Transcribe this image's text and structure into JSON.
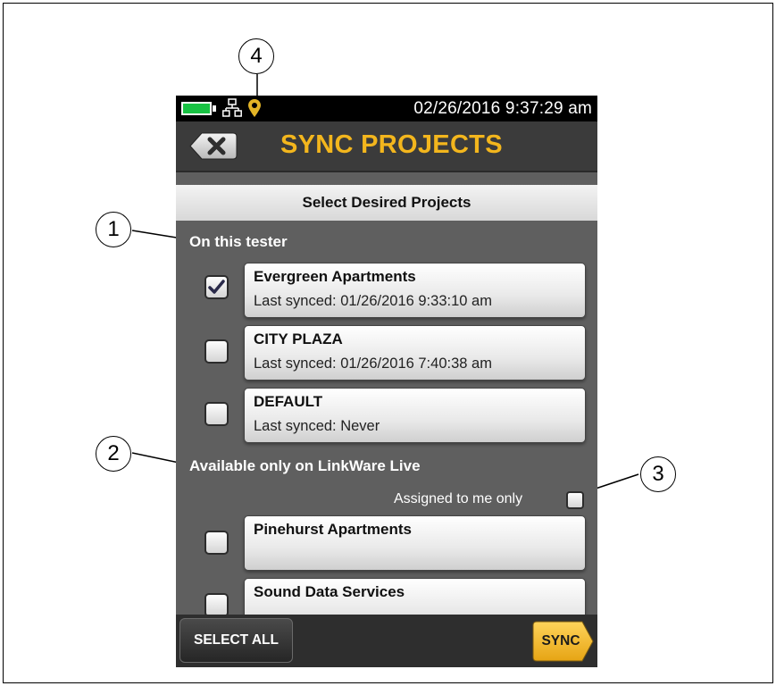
{
  "status": {
    "datetime": "02/26/2016 9:37:29 am",
    "battery_color": "#18c243"
  },
  "header": {
    "title": "SYNC PROJECTS",
    "title_color": "#f3b61d",
    "back_icon": "close-x-icon"
  },
  "subheader": "Select Desired Projects",
  "sections": {
    "tester_label": "On this tester",
    "linkware_label": "Available only on LinkWare Live"
  },
  "tester_projects": [
    {
      "name": "Evergreen Apartments",
      "sync": "Last synced: 01/26/2016 9:33:10 am",
      "checked": true
    },
    {
      "name": "CITY PLAZA",
      "sync": "Last synced: 01/26/2016 7:40:38 am",
      "checked": false
    },
    {
      "name": "DEFAULT",
      "sync": "Last synced: Never",
      "checked": false
    }
  ],
  "assigned_filter": {
    "label": "Assigned to me only",
    "checked": false
  },
  "linkware_projects": [
    {
      "name": "Pinehurst Apartments",
      "checked": false
    },
    {
      "name": "Sound Data Services",
      "checked": false
    }
  ],
  "footer": {
    "select_all": "SELECT ALL",
    "sync": "SYNC",
    "sync_color": "#f2b623"
  },
  "callouts": [
    "1",
    "2",
    "3",
    "4"
  ]
}
